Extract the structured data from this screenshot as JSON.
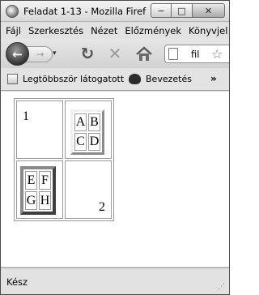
{
  "window": {
    "title": "Feladat 1-13 - Mozilla Firef",
    "controls": {
      "minimize": "−",
      "maximize": "□",
      "close": "✕"
    }
  },
  "menubar": {
    "items": [
      "Fájl",
      "Szerkesztés",
      "Nézet",
      "Előzmények",
      "Könyvjel"
    ]
  },
  "navbar": {
    "back_glyph": "←",
    "forward_glyph": "→",
    "dropdown_glyph": "▾",
    "reload_glyph": "↻",
    "stop_glyph": "✕",
    "url": "fil",
    "star_glyph": "☆"
  },
  "bookmarks": {
    "items": [
      "Legtöbbször látogatott",
      "Bevezetés"
    ],
    "chevron": "»"
  },
  "content": {
    "cell1": "1",
    "cell4": "2",
    "inner_raised": [
      [
        "A",
        "B"
      ],
      [
        "C",
        "D"
      ]
    ],
    "inner_sunken": [
      [
        "E",
        "F"
      ],
      [
        "G",
        "H"
      ]
    ]
  },
  "statusbar": {
    "text": "Kész"
  }
}
